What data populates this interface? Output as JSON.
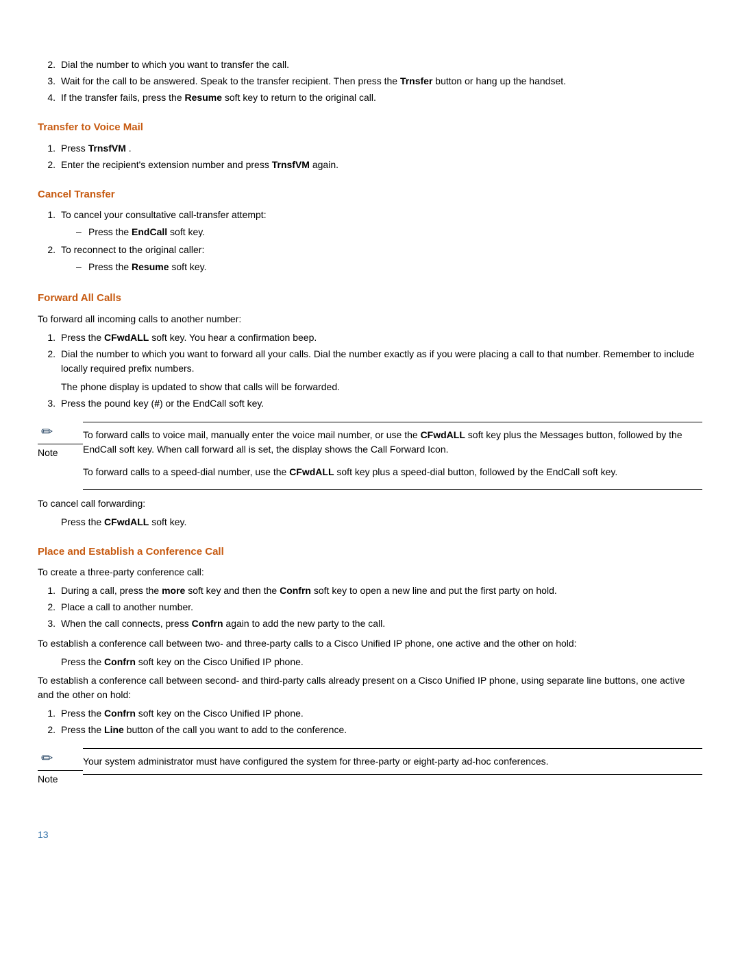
{
  "top_list": {
    "i2": "Dial the number to which you want to transfer the call.",
    "i3_a": "Wait for the call to be answered. Speak to",
    "i3_b": " the transfer recipient. Then press the ",
    "i3_c": "Trnsfer",
    "i3_d": " button or hang up the handset.",
    "i4_a": "If the transfer fails, press the ",
    "i4_b": "Resume",
    "i4_c": " soft key to return to the original call."
  },
  "transfer_vm": {
    "heading": "Transfer to Voice Mail",
    "i1_a": "Press ",
    "i1_b": "TrnsfVM",
    "i1_c": " .",
    "i2_a": "Enter the recipient's extension number and press ",
    "i2_b": "TrnsfVM",
    "i2_c": "  again."
  },
  "cancel_transfer": {
    "heading": "Cancel Transfer",
    "i1": "To cancel your consultative call-transfer attempt:",
    "i1s_a": "Press the ",
    "i1s_b": "EndCall",
    "i1s_c": " soft key.",
    "i2": "To reconnect to the original caller:",
    "i2s_a": "Press the ",
    "i2s_b": "Resume",
    "i2s_c": " soft key."
  },
  "fwd": {
    "heading": "Forward All Calls",
    "intro": "To forward all incoming calls to another number:",
    "i1_a": "Press the ",
    "i1_b": "CFwdALL",
    "i1_c": " soft key. You hear a confirmation beep.",
    "i2_a": "Dial the number to which you want to forward all your calls. Dial the number exactly as if you were placing a call to that number. Remember to include locally required prefix numbers.",
    "i2_b": "The phone display is updated to show that calls will be forwarded.",
    "i3_a": "Press the pound key (",
    "i3_b": "#",
    "i3_c": ") or the EndCall soft key.",
    "note_label": "Note",
    "note_p1_a": "To forward calls to voice mail, manually enter the voice mail number, or use the ",
    "note_p1_b": "CFwdALL",
    "note_p1_c": " soft key plus the Messages button, followed by the  EndCall soft key. When call forward all is set, the display shows the Call Forward Icon.",
    "note_p2_a": "To forward calls to a speed-dial number, use the ",
    "note_p2_b": "CFwdALL",
    "note_p2_c": " soft key plus a speed-dial button, followed by the  EndCall soft key.",
    "cancel_intro": "To cancel call forwarding:",
    "cancel_a": "Press the ",
    "cancel_b": "CFwdALL",
    "cancel_c": " soft key."
  },
  "conf": {
    "heading": "Place and Establish a Conference Call",
    "intro": "To create a three-party conference call:",
    "i1_a": "During a call, press the ",
    "i1_b": "more",
    "i1_c": " soft key and then the ",
    "i1_d": "Confrn",
    "i1_e": " soft key to open a new line and put the first party on hold.",
    "i2": "Place a call to another number.",
    "i3_a": "When the call connects, press ",
    "i3_b": "Confrn",
    "i3_c": " again to add the new party to the call.",
    "estA": "To establish a conference call between two- and three-party calls to a Cisco Unified IP phone, one active and the other on hold:",
    "estA_s_a": "Press the ",
    "estA_s_b": "Confrn",
    "estA_s_c": " soft key on the Cisco Unified IP phone.",
    "estB": "To establish a conference call between second- and third-party calls already present on a Cisco Unified IP phone, using separate line buttons, one active and the other on hold:",
    "bi1_a": "Press the ",
    "bi1_b": "Confrn",
    "bi1_c": " soft key on the Cisco Unified IP phone.",
    "bi2_a": "Press the ",
    "bi2_b": "Line",
    "bi2_c": " button of the call you want to add to the conference.",
    "note_label": "Note",
    "note_text": "Your system administrator must have configured the system for three-party or eight-party ad-hoc conferences."
  },
  "page_number": "13",
  "markers": {
    "n1": "1.",
    "n2": "2.",
    "n3": "3.",
    "n4": "4.",
    "dash": "–"
  }
}
